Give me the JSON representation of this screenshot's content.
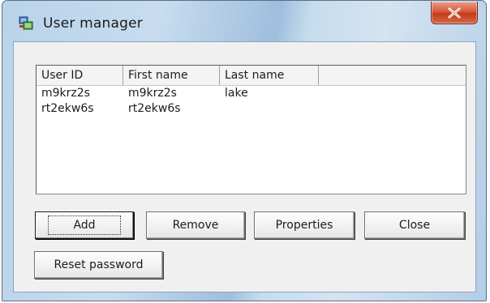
{
  "window": {
    "title": "User manager",
    "app_icon": "user-manager-app-icon",
    "close_icon": "close-x-icon",
    "accent_close": "#c23a1b"
  },
  "list": {
    "columns": [
      "User ID",
      "First name",
      "Last name",
      ""
    ],
    "rows": [
      [
        "m9krz2s",
        "m9krz2s",
        "lake"
      ],
      [
        "rt2ekw6s",
        "rt2ekw6s",
        ""
      ]
    ]
  },
  "buttons": {
    "add": "Add",
    "remove": "Remove",
    "properties": "Properties",
    "close": "Close",
    "reset_password": "Reset password"
  }
}
